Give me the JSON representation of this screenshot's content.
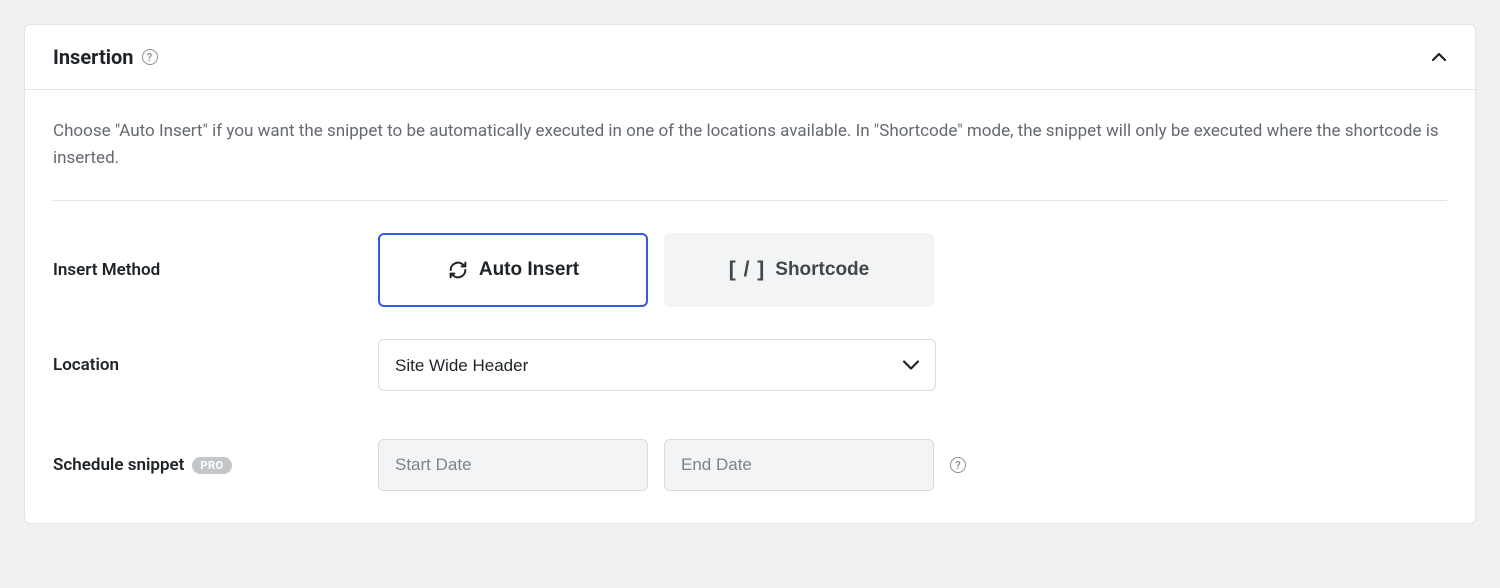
{
  "panel": {
    "title": "Insertion",
    "description": "Choose \"Auto Insert\" if you want the snippet to be automatically executed in one of the locations available. In \"Shortcode\" mode, the snippet will only be executed where the shortcode is inserted."
  },
  "form": {
    "insert_method": {
      "label": "Insert Method",
      "auto_insert": "Auto Insert",
      "shortcode": "Shortcode"
    },
    "location": {
      "label": "Location",
      "value": "Site Wide Header"
    },
    "schedule": {
      "label": "Schedule snippet",
      "badge": "PRO",
      "start_placeholder": "Start Date",
      "end_placeholder": "End Date"
    }
  }
}
